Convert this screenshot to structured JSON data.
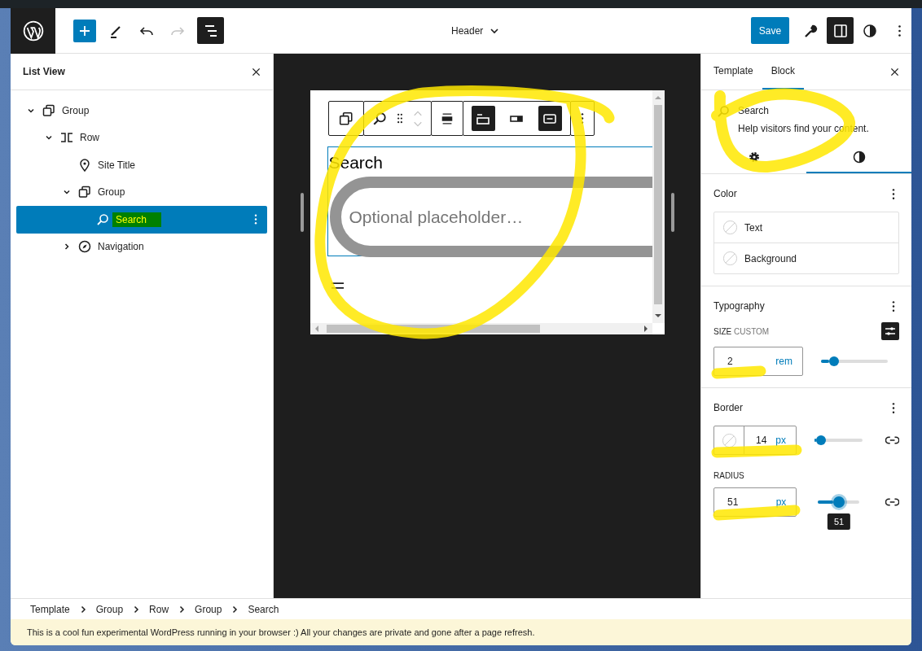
{
  "top_bar": {
    "document_title": "Header",
    "save_label": "Save"
  },
  "list_view": {
    "title": "List View",
    "tree": [
      {
        "label": "Group",
        "kind": "group",
        "expanded": true,
        "selected": false,
        "children": [
          {
            "label": "Row",
            "kind": "row",
            "expanded": true,
            "selected": false,
            "children": [
              {
                "label": "Site Title",
                "kind": "site-title",
                "selected": false
              },
              {
                "label": "Group",
                "kind": "group",
                "expanded": true,
                "selected": false,
                "children": [
                  {
                    "label": "Search",
                    "kind": "search",
                    "selected": true
                  }
                ]
              },
              {
                "label": "Navigation",
                "kind": "navigation",
                "expanded": false,
                "selected": false
              }
            ]
          }
        ]
      }
    ]
  },
  "canvas": {
    "toggles": [
      {
        "kind": "label",
        "on": true
      },
      {
        "kind": "inside",
        "on": false
      },
      {
        "kind": "button",
        "on": true
      }
    ],
    "block_label": "Search",
    "placeholder": "Optional placeholder…"
  },
  "sidebar": {
    "tabs": [
      {
        "label": "Template",
        "selected": false
      },
      {
        "label": "Block",
        "selected": true
      }
    ],
    "block_card": {
      "title": "Search",
      "description": "Help visitors find your content."
    },
    "style_tabs": [
      {
        "kind": "settings",
        "selected": false
      },
      {
        "kind": "styles",
        "selected": true
      }
    ],
    "color": {
      "title": "Color",
      "items": [
        "Text",
        "Background"
      ]
    },
    "typography": {
      "title": "Typography",
      "size_label": "SIZE",
      "size_mode": "CUSTOM",
      "value": "2",
      "unit": "rem",
      "level": 0.2
    },
    "border": {
      "title": "Border",
      "width": {
        "value": "14",
        "unit": "px",
        "level": 0.13
      },
      "radius": {
        "label": "RADIUS",
        "value": "51",
        "unit": "px",
        "level": 0.51,
        "tooltip": "51"
      }
    }
  },
  "breadcrumbs": [
    "Template",
    "Group",
    "Row",
    "Group",
    "Search"
  ],
  "notice": "This is a cool fun experimental WordPress running in your browser :) All your changes are private and gone after a page refresh."
}
